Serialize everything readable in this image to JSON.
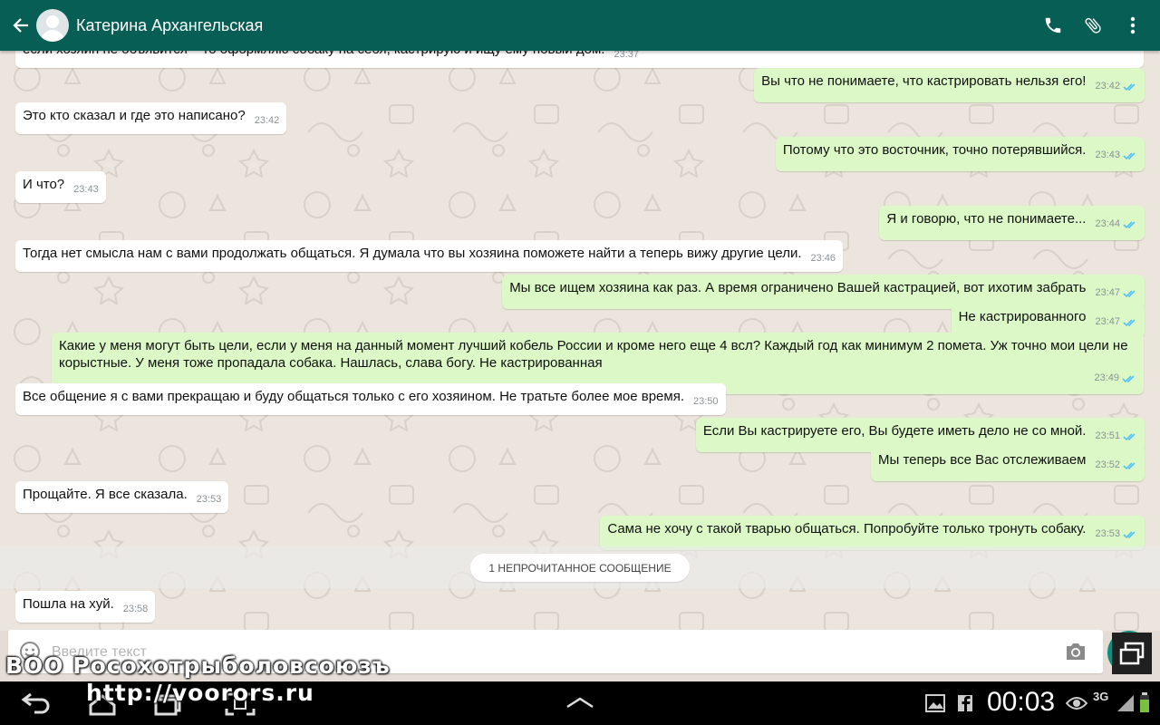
{
  "header": {
    "contact_name": "Катерина Архангельская",
    "icons": [
      "back-arrow-icon",
      "avatar",
      "phone-icon",
      "paperclip-icon",
      "more-vert-icon"
    ],
    "color": "#075e54"
  },
  "messages": [
    {
      "dir": "in",
      "text": "если хозяин не объявится – то оформляю собаку на себя, кастрирую и ищу ему новый дом.",
      "time": "23:37",
      "partial": true
    },
    {
      "dir": "out",
      "text": "Вы что не понимаете, что кастрировать нельзя его!",
      "time": "23:42"
    },
    {
      "dir": "in",
      "text": "Это кто сказал и где это написано?",
      "time": "23:42"
    },
    {
      "dir": "out",
      "text": "Потому что это восточник, точно потерявшийся.",
      "time": "23:43"
    },
    {
      "dir": "in",
      "text": "И что?",
      "time": "23:43"
    },
    {
      "dir": "out",
      "text": "Я и говорю, что не понимаете...",
      "time": "23:44"
    },
    {
      "dir": "in",
      "text": "Тогда нет смысла нам с вами продолжать общаться.  Я думала что вы хозяина поможете найти а теперь вижу другие цели.",
      "time": "23:46"
    },
    {
      "dir": "out",
      "text": "Мы все ищем хозяина как раз. А время ограничено Вашей кастрацией, вот ихотим забрать",
      "time": "23:47"
    },
    {
      "dir": "out",
      "text": "Не кастрированного",
      "time": "23:47"
    },
    {
      "dir": "out",
      "text": "Какие у меня могут быть цели, если у меня на данный момент лучший кобель России и кроме него еще 4 всл? Каждый год как минимум 2 помета. Уж точно мои цели не корыстные. У меня тоже пропадала собака. Нашлась, слава богу. Не кастрированная",
      "time": "23:49"
    },
    {
      "dir": "in",
      "text": "Все общение я с вами прекращаю и буду общаться только с его хозяином. Не тратьте более мое время.",
      "time": "23:50"
    },
    {
      "dir": "out",
      "text": "Если Вы кастрируете его, Вы будете иметь дело не со мной.",
      "time": "23:51"
    },
    {
      "dir": "out",
      "text": "Мы теперь все Вас отслеживаем",
      "time": "23:52"
    },
    {
      "dir": "in",
      "text": "Прощайте. Я все сказала.",
      "time": "23:53"
    },
    {
      "dir": "out",
      "text": "Сама не хочу с такой тварью общаться. Попробуйте только тронуть собаку.",
      "time": "23:53"
    },
    {
      "dir": "in",
      "text": "Пошла на хуй.",
      "time": "23:58"
    }
  ],
  "unread_banner": "1 НЕПРОЧИТАННОЕ СООБЩЕНИЕ",
  "composer": {
    "placeholder": "Введите текст"
  },
  "status_bar": {
    "time": "00:03",
    "network": "3G"
  },
  "watermark": {
    "line1": "ВОО Росохотрыболовсоюзъ",
    "line2": "http://voorors.ru"
  },
  "colors": {
    "incoming": "#ffffff",
    "outgoing": "#dcf8c6",
    "tick": "#4fc3f7"
  }
}
